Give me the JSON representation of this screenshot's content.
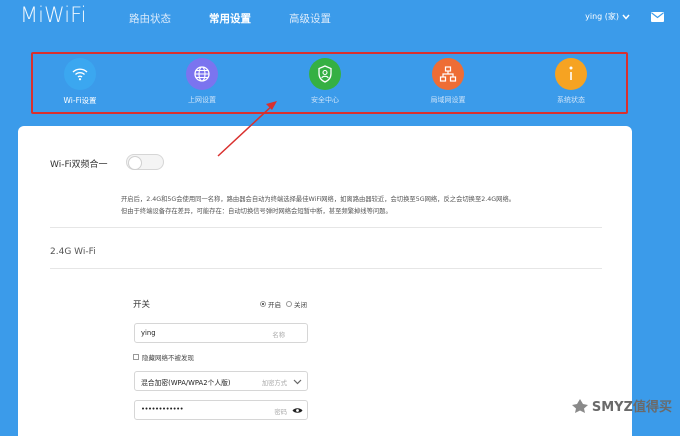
{
  "header": {
    "logo": "MiWiFi",
    "tabs": [
      {
        "label": "路由状态",
        "active": false
      },
      {
        "label": "常用设置",
        "active": true
      },
      {
        "label": "高级设置",
        "active": false
      }
    ],
    "user": "ying (家)",
    "icons": [
      "chevron-down-icon",
      "mail-icon"
    ]
  },
  "features": [
    {
      "label": "Wi-Fi设置",
      "color": "#3ba7f0",
      "icon": "wifi-icon",
      "active": true
    },
    {
      "label": "上网设置",
      "color": "#7b74ef",
      "icon": "globe-icon",
      "active": false
    },
    {
      "label": "安全中心",
      "color": "#35b043",
      "icon": "shield-icon",
      "active": false
    },
    {
      "label": "局域网设置",
      "color": "#ee6d35",
      "icon": "network-icon",
      "active": false
    },
    {
      "label": "系统状态",
      "color": "#f6a322",
      "icon": "info-icon",
      "active": false
    }
  ],
  "wifi": {
    "dual_band_label": "Wi-Fi双频合一",
    "dual_band_on": false,
    "description": [
      "开启后，2.4G和5G会使用同一名称，路由器会自动为终端选择最佳WiFi网络，如离路由器较近，会切换至5G网络，反之会切换至2.4G网络。",
      "但由于终端设备存在差异，可能存在：自动切换信号弹时网络会短暂中断，甚至频繁掉线等问题。"
    ],
    "section_title": "2.4G Wi-Fi",
    "switch_label": "开关",
    "radio_on": "开启",
    "radio_off": "关闭",
    "ssid_value": "ying",
    "ssid_placeholder": "名称",
    "hide_network_label": "隐藏网络不被发现",
    "encryption_value": "混合加密(WPA/WPA2个人版)",
    "encryption_placeholder": "加密方式",
    "password_value": "••••••••••••",
    "password_placeholder": "密码"
  },
  "watermark": "SMYZ值得买",
  "colors": {
    "background": "#3b9bea",
    "annotation": "#d9302e"
  }
}
